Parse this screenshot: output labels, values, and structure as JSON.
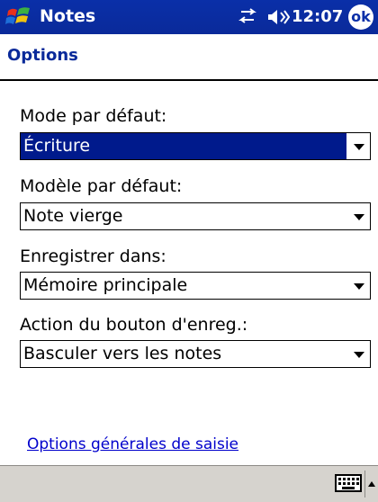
{
  "titlebar": {
    "app_title": "Notes",
    "clock": "12:07",
    "ok_label": "ok",
    "icons": [
      "windows-start-icon",
      "connectivity-icon",
      "volume-icon"
    ]
  },
  "page": {
    "title": "Options"
  },
  "form": {
    "fields": [
      {
        "label": "Mode par défaut:",
        "value": "Écriture",
        "focused": true
      },
      {
        "label": "Modèle par défaut:",
        "value": "Note vierge",
        "focused": false
      },
      {
        "label": "Enregistrer dans:",
        "value": "Mémoire principale",
        "focused": false
      },
      {
        "label": "Action du bouton d'enreg.:",
        "value": "Basculer vers les notes",
        "focused": false
      }
    ]
  },
  "link": {
    "text": "Options générales de saisie"
  },
  "menubar": {
    "icons": [
      "keyboard-icon",
      "sip-up-arrow-icon"
    ]
  },
  "colors": {
    "titlebar": "#0a2fa8",
    "heading": "#0a2a9a",
    "focus": "#001a8c",
    "link": "#0000cc",
    "menubar": "#d6d3ce"
  }
}
